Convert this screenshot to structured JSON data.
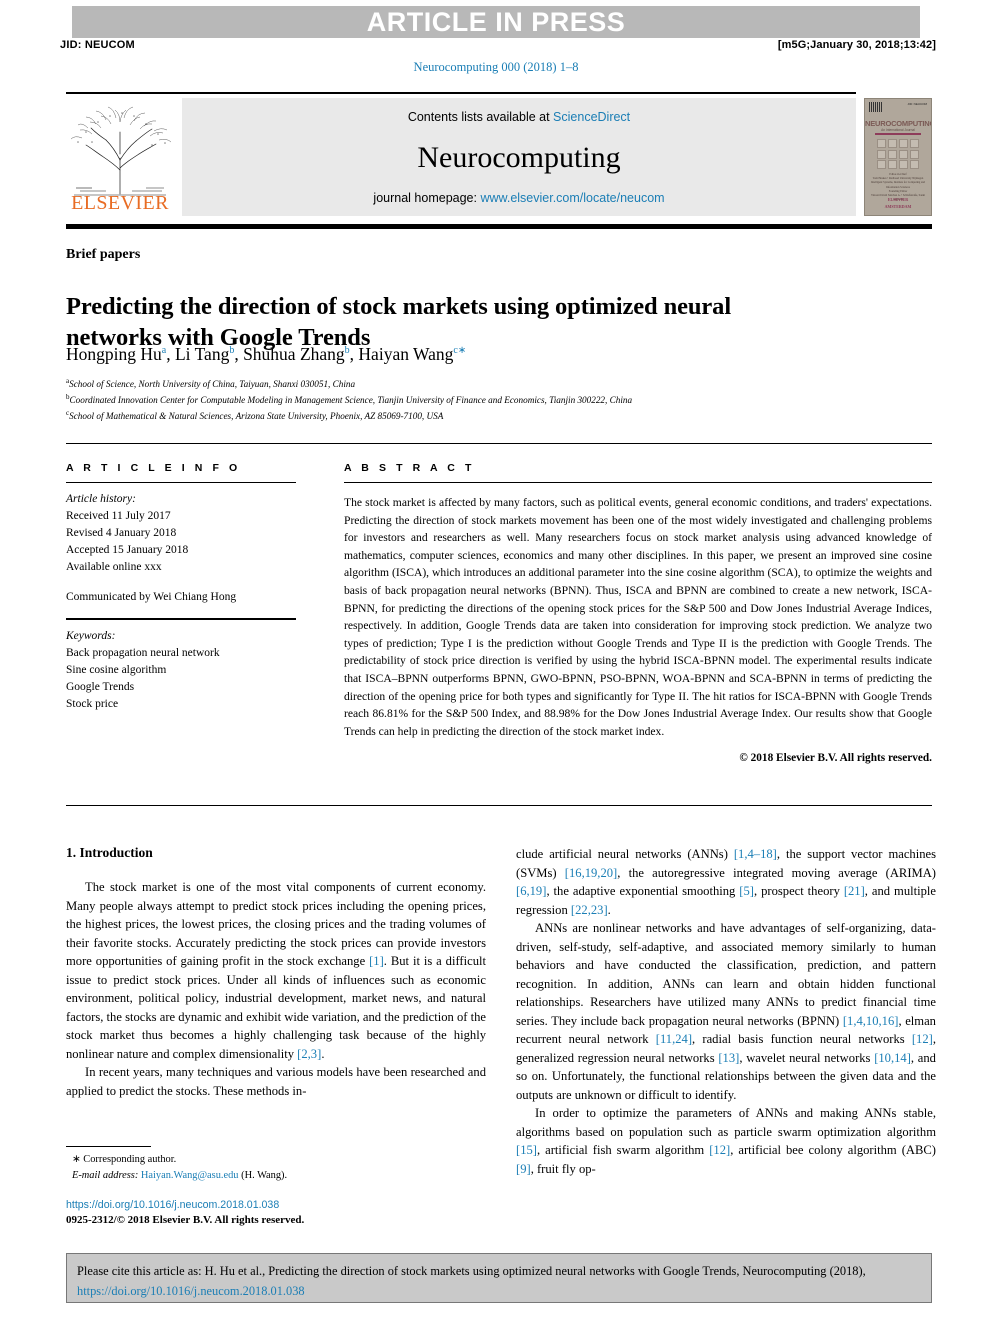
{
  "running_head": {
    "article_in_press": "ARTICLE IN PRESS",
    "jid": "JID: NEUCOM",
    "build_stamp": "[m5G;January 30, 2018;13:42]",
    "journal_ref": "Neurocomputing 000 (2018) 1–8"
  },
  "masthead": {
    "contents_prefix": "Contents lists available at ",
    "sciencedirect": "ScienceDirect",
    "journal_title": "Neurocomputing",
    "homepage_prefix": "journal homepage: ",
    "homepage_url": "www.elsevier.com/locate/neucom",
    "publisher": "ELSEVIER",
    "cover": {
      "title": "NEUROCOMPUTING",
      "subtitle": "An International Journal",
      "editor_label": "Editor-in-Chief",
      "editor_lines": "Tom Heskes  •  Radboud University Nijmegen\nIntelligent Systems, Institute for Computing and Information Sciences",
      "founding_label": "Founding Editor",
      "founding_lines": "Vincent David Sánchez A.  •  Schloßstraße, Sankt Augustin",
      "imprint_label": "ELSEVIER",
      "imprint_sub": "AMSTERDAM"
    }
  },
  "article": {
    "section_label": "Brief papers",
    "title": "Predicting the direction of stock markets using optimized neural networks with Google Trends",
    "authors": [
      {
        "name": "Hongping Hu",
        "sup": "a",
        "sep": ", "
      },
      {
        "name": "Li Tang",
        "sup": "b",
        "sep": ", "
      },
      {
        "name": "Shuhua Zhang",
        "sup": "b",
        "sep": ", "
      },
      {
        "name": "Haiyan Wang",
        "sup": "c",
        "sep": "",
        "corresponding": "∗"
      }
    ],
    "affiliations": [
      {
        "marker": "a",
        "text": "School of Science, North University of China, Taiyuan, Shanxi 030051, China"
      },
      {
        "marker": "b",
        "text": "Coordinated Innovation Center for Computable Modeling in Management Science, Tianjin University of Finance and Economics, Tianjin 300222, China"
      },
      {
        "marker": "c",
        "text": "School of Mathematical & Natural Sciences, Arizona State University, Phoenix, AZ 85069-7100, USA"
      }
    ]
  },
  "article_info": {
    "heading": "A R T I C L E   I N F O",
    "history_label": "Article history:",
    "history": [
      "Received 11 July 2017",
      "Revised 4 January 2018",
      "Accepted 15 January 2018",
      "Available online xxx"
    ],
    "communicated_by": "Communicated by Wei Chiang Hong",
    "keywords_label": "Keywords:",
    "keywords": [
      "Back propagation neural network",
      "Sine cosine algorithm",
      "Google Trends",
      "Stock price"
    ]
  },
  "abstract": {
    "heading": "A B S T R A C T",
    "text": "The stock market is affected by many factors, such as political events, general economic conditions, and traders' expectations. Predicting the direction of stock markets movement has been one of the most widely investigated and challenging problems for investors and researchers as well. Many researchers focus on stock market analysis using advanced knowledge of mathematics, computer sciences, economics and many other disciplines. In this paper, we present an improved sine cosine algorithm (ISCA), which introduces an additional parameter into the sine cosine algorithm (SCA), to optimize the weights and basis of back propagation neural networks (BPNN). Thus, ISCA and BPNN are combined to create a new network, ISCA-BPNN, for predicting the directions of the opening stock prices for the S&P 500 and Dow Jones Industrial Average Indices, respectively. In addition, Google Trends data are taken into consideration for improving stock prediction. We analyze two types of prediction; Type I is the prediction without Google Trends and Type II is the prediction with Google Trends. The predictability of stock price direction is verified by using the hybrid ISCA-BPNN model. The experimental results indicate that ISCA–BPNN outperforms BPNN, GWO-BPNN, PSO-BPNN, WOA-BPNN and SCA-BPNN in terms of predicting the direction of the opening price for both types and significantly for Type II. The hit ratios for ISCA-BPNN with Google Trends reach 86.81% for the S&P 500 Index, and 88.98% for the Dow Jones Industrial Average Index. Our results show that Google Trends can help in predicting the direction of the stock market index.",
    "copyright": "© 2018 Elsevier B.V. All rights reserved."
  },
  "introduction": {
    "heading": "1. Introduction",
    "left_paragraphs": [
      "The stock market is one of the most vital components of current economy. Many people always attempt to predict stock prices including the opening prices, the highest prices, the lowest prices, the closing prices and the trading volumes of their favorite stocks. Accurately predicting the stock prices can provide investors more opportunities of gaining profit in the stock exchange [1]. But it is a difficult issue to predict stock prices. Under all kinds of influences such as economic environment, political policy, industrial development, market news, and natural factors, the stocks are dynamic and exhibit wide variation, and the prediction of the stock market thus becomes a highly challenging task because of the highly nonlinear nature and complex dimensionality [2,3].",
      "In recent years, many techniques and various models have been researched and applied to predict the stocks. These methods in-"
    ],
    "right_paragraphs": [
      "clude artificial neural networks (ANNs) [1,4–18], the support vector machines (SVMs) [16,19,20], the autoregressive integrated moving average (ARIMA) [6,19], the adaptive exponential smoothing [5], prospect theory [21], and multiple regression [22,23].",
      "ANNs are nonlinear networks and have advantages of self-organizing, data-driven, self-study, self-adaptive, and associated memory similarly to human behaviors and have conducted the classification, prediction, and pattern recognition. In addition, ANNs can learn and obtain hidden functional relationships. Researchers have utilized many ANNs to predict financial time series. They include back propagation neural networks (BPNN) [1,4,10,16], elman recurrent neural network [11,24], radial basis function neural networks [12], generalized regression neural networks [13], wavelet neural networks [10,14], and so on. Unfortunately, the functional relationships between the given data and the outputs are unknown or difficult to identify.",
      "In order to optimize the parameters of ANNs and making ANNs stable, algorithms based on population such as particle swarm optimization algorithm [15], artificial fish swarm algorithm [12], artificial bee colony algorithm (ABC) [9], fruit fly op-"
    ]
  },
  "footnote": {
    "corresponding": "∗ Corresponding author.",
    "email_label": "E-mail address:",
    "email": "Haiyan.Wang@asu.edu",
    "email_suffix": "(H. Wang)."
  },
  "footer": {
    "doi": "https://doi.org/10.1016/j.neucom.2018.01.038",
    "issn_line": "0925-2312/© 2018 Elsevier B.V. All rights reserved."
  },
  "cite_box": {
    "text": "Please cite this article as: H. Hu et al., Predicting the direction of stock markets using optimized neural networks with Google Trends, Neurocomputing (2018), ",
    "doi": "https://doi.org/10.1016/j.neucom.2018.01.038"
  },
  "colors": {
    "link": "#1b7eb5",
    "band": "#b8b8b8",
    "masthead_box": "#e9e9e9",
    "cite_box": "#c9c9c9",
    "elsevier_orange": "#e86c24"
  }
}
